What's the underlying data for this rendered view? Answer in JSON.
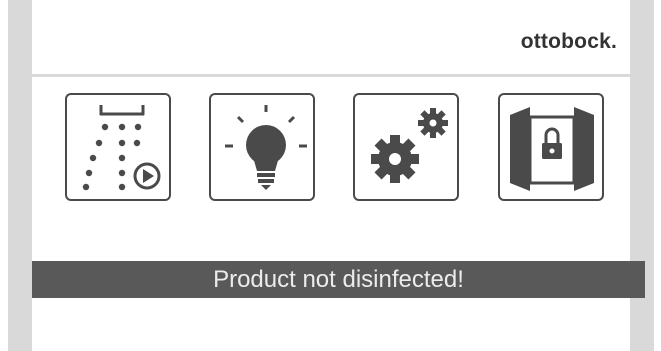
{
  "brand": {
    "logo_text": "ottobock."
  },
  "tiles": [
    {
      "icon": "disinfection-spray-play-icon"
    },
    {
      "icon": "light-bulb-icon"
    },
    {
      "icon": "settings-gears-icon"
    },
    {
      "icon": "door-lock-icon"
    }
  ],
  "status": {
    "message": "Product not disinfected!"
  },
  "colors": {
    "status_bg": "#595959",
    "status_text": "#ececec",
    "icon": "#4a4a4a",
    "side_bars": "#d9d9d9"
  }
}
